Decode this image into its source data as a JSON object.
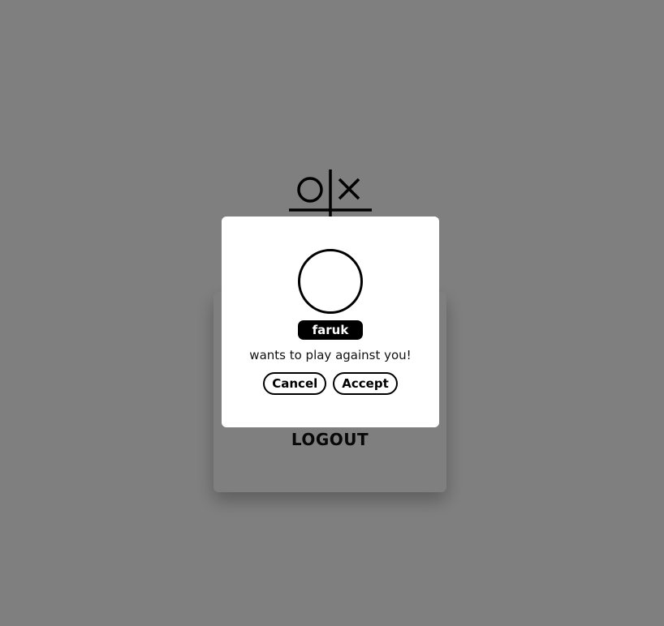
{
  "background": {
    "logo": {
      "icon": "tic-tac-toe-logo-icon"
    },
    "menu": {
      "logout_label": "LOGOUT"
    }
  },
  "modal": {
    "avatar_icon": "avatar-circle-icon",
    "username": "faruk",
    "message": "wants to play against you!",
    "cancel_label": "Cancel",
    "accept_label": "Accept"
  },
  "colors": {
    "overlay": "#808080",
    "modal_background": "#ffffff",
    "badge_background": "#000000",
    "badge_text": "#ffffff",
    "text": "#111111"
  }
}
